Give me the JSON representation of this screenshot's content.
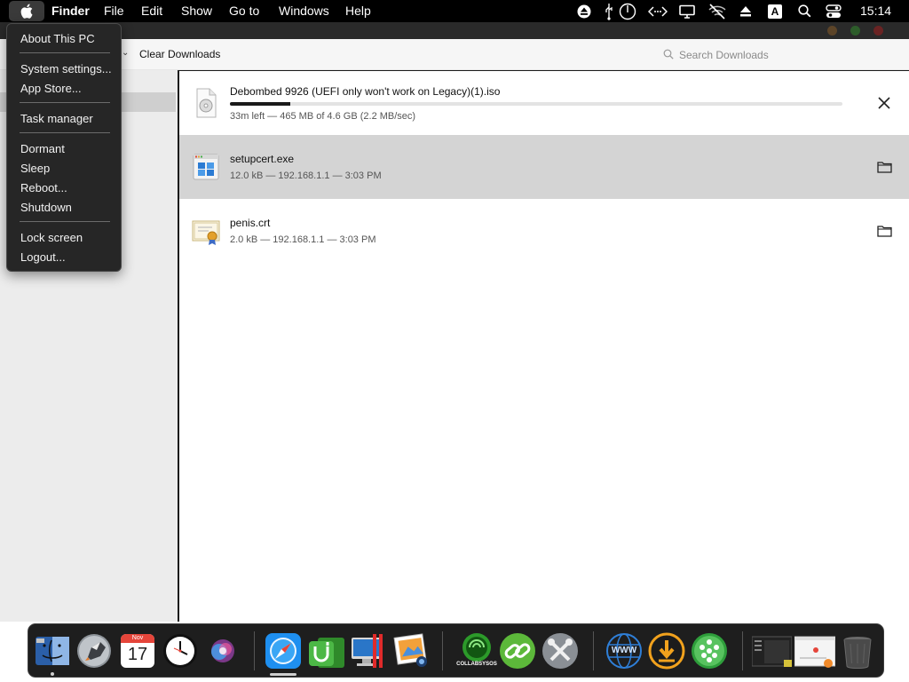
{
  "menubar": {
    "app_name": "Finder",
    "menus": [
      "File",
      "Edit",
      "Show",
      "Go to",
      "Windows",
      "Help"
    ],
    "status_icons": [
      "eject-icon",
      "usb-icon",
      "power-icon",
      "network-code-icon",
      "display-icon",
      "wifi-off-icon",
      "eject-triangle-icon",
      "keyboard-input-icon",
      "search-icon",
      "control-center-icon"
    ],
    "input_source_label": "A",
    "clock": "15:14"
  },
  "apple_menu": {
    "items": [
      "About This PC",
      "System settings...",
      "App Store...",
      "Task manager",
      "Dormant",
      "Sleep",
      "Reboot...",
      "Shutdown",
      "Lock screen",
      "Logout..."
    ]
  },
  "toolbar": {
    "clear_label": "Clear Downloads",
    "search_placeholder": "Search Downloads"
  },
  "downloads": [
    {
      "name": "Debombed 9926 (UEFI only won't work on Legacy)(1).iso",
      "meta": "33m left — 465 MB of 4.6 GB (2.2 MB/sec)",
      "progress": 0.098,
      "action_icon": "close-icon",
      "file_icon": "disk-image-icon"
    },
    {
      "name": "setupcert.exe",
      "meta": "12.0 kB — 192.168.1.1 — 3:03 PM",
      "action_icon": "folder-icon",
      "file_icon": "exe-file-icon"
    },
    {
      "name": "penis.crt",
      "meta": "2.0 kB — 192.168.1.1 — 3:03 PM",
      "action_icon": "folder-icon",
      "file_icon": "certificate-icon"
    }
  ],
  "dock": {
    "apps": [
      "finder-icon",
      "launchpad-icon",
      "calendar-icon",
      "clock-icon",
      "siri-icon",
      "safari-icon",
      "utorrent-icon",
      "remote-desktop-icon",
      "preview-icon",
      "collabsysos-icon",
      "link-icon",
      "system-tools-icon",
      "www-icon",
      "downloader-icon",
      "network-people-icon",
      "window-thumbnail-icon",
      "browser-thumbnail-icon",
      "trash-icon"
    ],
    "calendar_month": "Nov",
    "calendar_day": "17",
    "collab_label": "COLLABSYSOS",
    "www_label": "WWW"
  },
  "colors": {
    "menubar_bg": "#000000",
    "menu_bg": "#262626",
    "selected_row": "#d4d4d4",
    "progress_fill": "#1a1a1a",
    "dock_bg": "#1e1e1e"
  }
}
